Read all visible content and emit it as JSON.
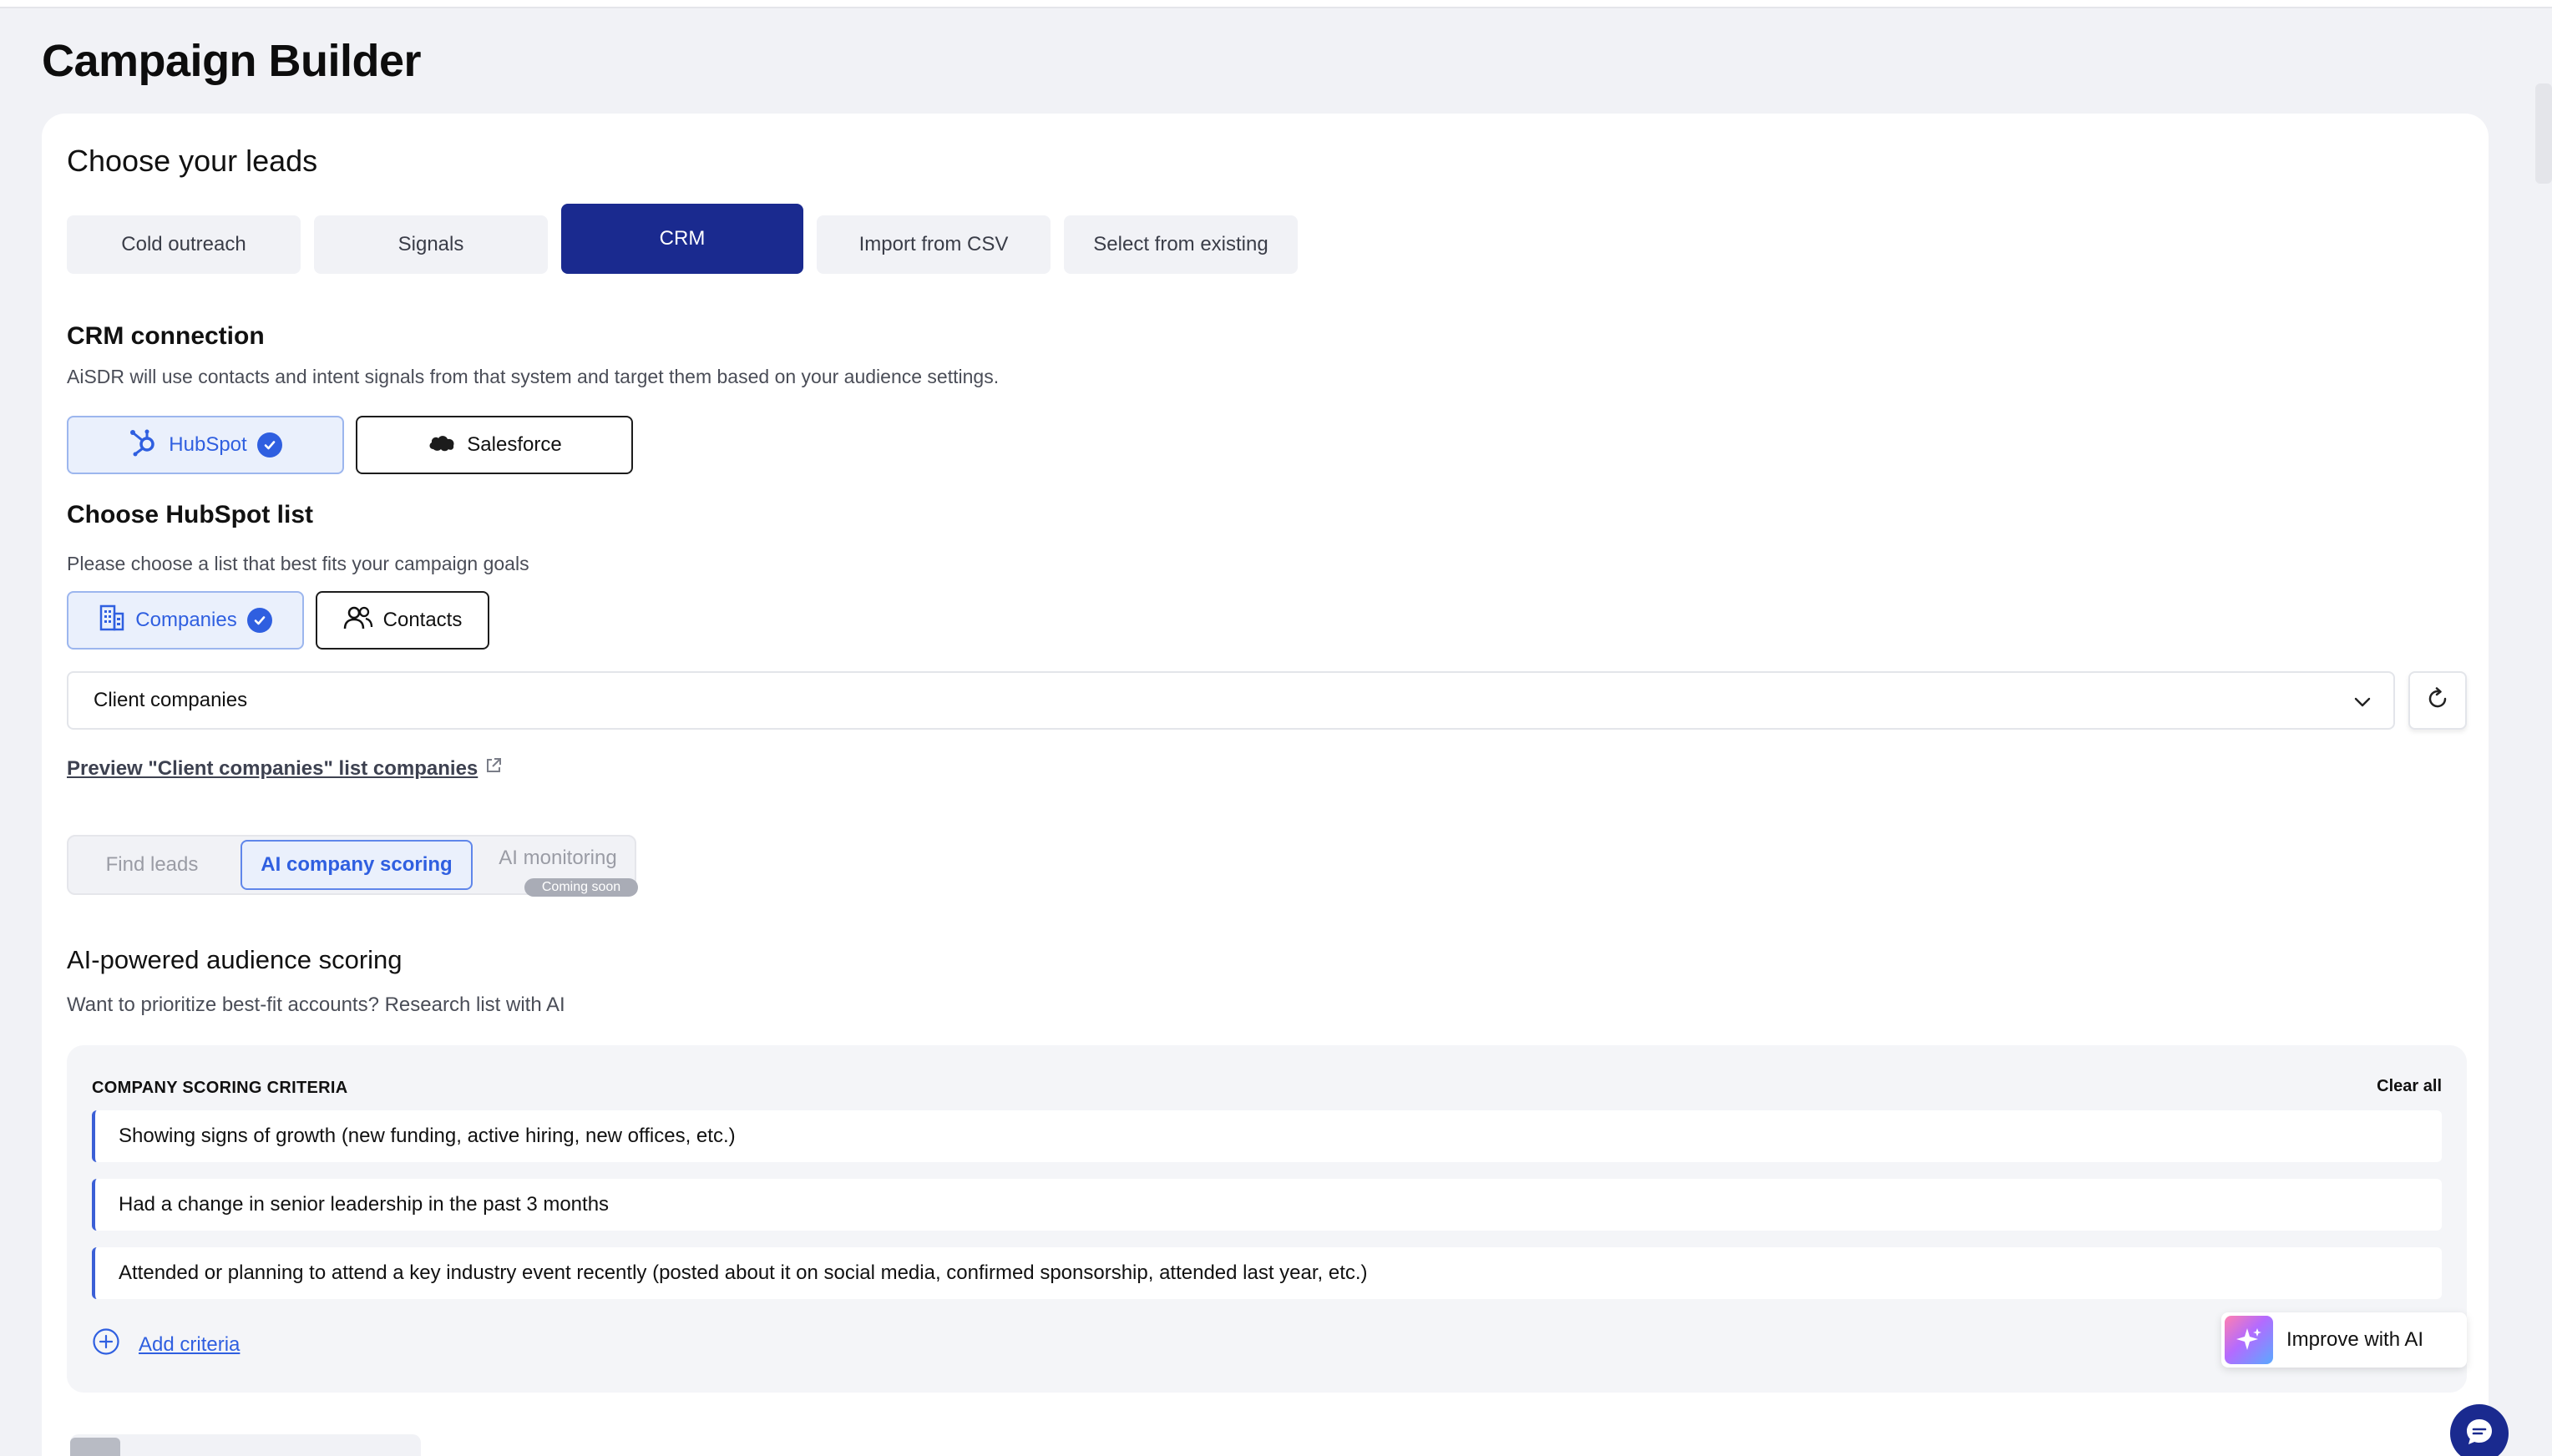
{
  "page": {
    "title": "Campaign Builder"
  },
  "leads": {
    "title": "Choose your leads",
    "tabs": [
      {
        "label": "Cold outreach",
        "active": false
      },
      {
        "label": "Signals",
        "active": false
      },
      {
        "label": "CRM",
        "active": true
      },
      {
        "label": "Import from CSV",
        "active": false
      },
      {
        "label": "Select from existing",
        "active": false
      }
    ]
  },
  "crm": {
    "title": "CRM connection",
    "description": "AiSDR will use contacts and intent signals from that system and target them based on your audience settings.",
    "options": [
      {
        "label": "HubSpot",
        "selected": true,
        "icon": "hubspot-icon"
      },
      {
        "label": "Salesforce",
        "selected": false,
        "icon": "salesforce-icon"
      }
    ]
  },
  "hubspot_list": {
    "title": "Choose HubSpot list",
    "description": "Please choose a list that best fits your campaign goals",
    "types": [
      {
        "label": "Companies",
        "selected": true,
        "icon": "building-icon"
      },
      {
        "label": "Contacts",
        "selected": false,
        "icon": "users-icon"
      }
    ],
    "selected_list": "Client companies",
    "preview_link": "Preview \"Client companies\" list companies"
  },
  "mode_tabs": {
    "items": [
      {
        "label": "Find leads",
        "active": false
      },
      {
        "label": "AI company scoring",
        "active": true
      },
      {
        "label": "AI monitoring",
        "active": false,
        "badge": "Coming soon"
      }
    ]
  },
  "scoring": {
    "title": "AI-powered audience scoring",
    "description": "Want to prioritize best-fit accounts? Research list with AI",
    "criteria_header": "COMPANY SCORING CRITERIA",
    "clear_all": "Clear all",
    "criteria": [
      "Showing signs of growth (new funding, active hiring, new offices, etc.)",
      "Had a change in senior leadership in the past 3 months",
      "Attended or planning to attend a key industry event recently (posted about it on social media, confirmed sponsorship, attended last year, etc.)"
    ],
    "add_criteria": "Add criteria",
    "improve_button": "Improve with AI"
  },
  "colors": {
    "primary": "#1a2a8f",
    "accent": "#2f5fe0",
    "selected_bg": "#eaf0fc",
    "page_bg": "#f1f2f6"
  }
}
